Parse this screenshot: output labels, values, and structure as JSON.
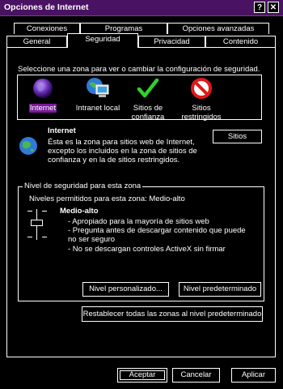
{
  "window": {
    "title": "Opciones de Internet",
    "help_glyph": "?",
    "close_glyph": "✕"
  },
  "tabs": {
    "row_back": [
      "Conexiones",
      "Programas",
      "Opciones avanzadas"
    ],
    "row_front": [
      "General",
      "Seguridad",
      "Privacidad",
      "Contenido"
    ],
    "active": "Seguridad"
  },
  "zones": {
    "prompt": "Seleccione una zona para ver o cambiar la configuración de seguridad.",
    "items": [
      {
        "label": "Internet",
        "icon": "globe-icon",
        "selected": true
      },
      {
        "label": "Intranet local",
        "icon": "computer-globe-icon",
        "selected": false
      },
      {
        "label": "Sitios de confianza",
        "icon": "checkmark-icon",
        "selected": false
      },
      {
        "label": "Sitios restringidos",
        "icon": "no-entry-icon",
        "selected": false
      }
    ]
  },
  "zone_info": {
    "title": "Internet",
    "description": "Ésta es la zona para sitios web de Internet, excepto los incluidos en la zona de sitios de confianza y en la de sitios restringidos.",
    "sites_button": "Sitios"
  },
  "security_level": {
    "group_label": "Nivel de seguridad para esta zona",
    "allowed_levels": "Niveles permitidos para esta zona: Medio-alto",
    "level_name": "Medio-alto",
    "bullets": [
      "- Apropiado para la mayoría de sitios web",
      "- Pregunta antes de descargar contenido que puede no ser seguro",
      "- No se descargan controles ActiveX sin firmar"
    ],
    "custom_button": "Nivel personalizado...",
    "default_button": "Nivel predeterminado"
  },
  "reset_button": "Restablecer todas las zonas al nivel predeterminado",
  "footer": {
    "ok": "Aceptar",
    "cancel": "Cancelar",
    "apply": "Aplicar"
  },
  "colors": {
    "titlebar": "#4a1262",
    "selection": "#7a1a9a",
    "background": "#000000",
    "foreground": "#ffffff"
  }
}
